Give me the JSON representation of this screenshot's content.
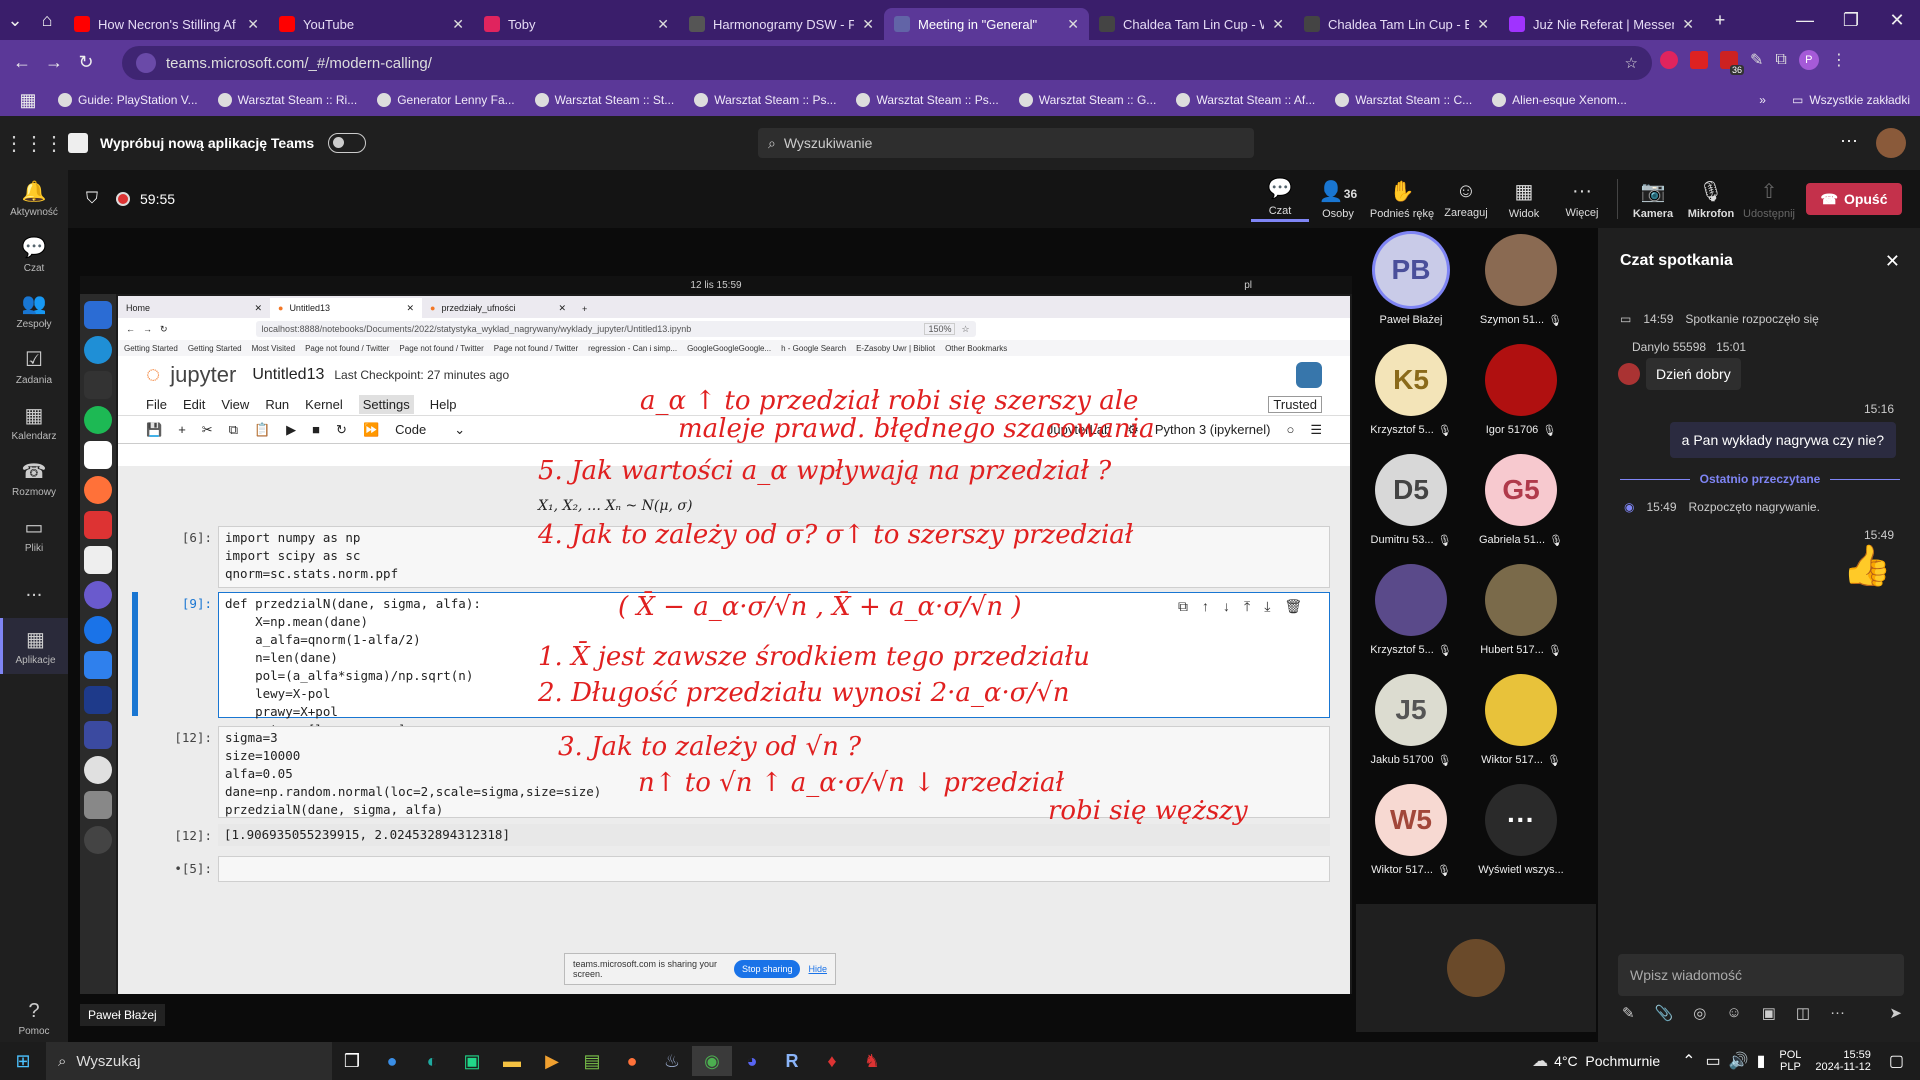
{
  "browser": {
    "tabs": [
      {
        "label": "How Necron's Stilling Af",
        "icon": "youtube-icon",
        "color": "#ff0000"
      },
      {
        "label": "YouTube",
        "icon": "youtube-icon",
        "color": "#ff0000"
      },
      {
        "label": "Toby",
        "icon": "toby-icon",
        "color": "#e0245e"
      },
      {
        "label": "Harmonogramy DSW - P",
        "icon": "wp-icon",
        "color": "#555"
      },
      {
        "label": "Meeting in \"General\"",
        "icon": "teams-icon",
        "color": "#6264a7"
      },
      {
        "label": "Chaldea Tam Lin Cup - W",
        "icon": "chaldea-icon",
        "color": "#444"
      },
      {
        "label": "Chaldea Tam Lin Cup - E",
        "icon": "chaldea-icon",
        "color": "#444"
      },
      {
        "label": "Już Nie Referat | Messen",
        "icon": "messenger-icon",
        "color": "#a033ff"
      }
    ],
    "url": "teams.microsoft.com/_#/modern-calling/",
    "bookmarks": [
      "Guide: PlayStation V...",
      "Warsztat Steam :: Ri...",
      "Generator Lenny Fa...",
      "Warsztat Steam :: St...",
      "Warsztat Steam :: Ps...",
      "Warsztat Steam :: Ps...",
      "Warsztat Steam :: G...",
      "Warsztat Steam :: Af...",
      "Warsztat Steam :: C...",
      "Alien-esque Xenom..."
    ],
    "bookmarks_all": "Wszystkie zakładki",
    "ext_badge": "36"
  },
  "teams": {
    "try_new": "Wypróbuj nową aplikację Teams",
    "search_placeholder": "Wyszukiwanie",
    "rail": [
      "Aktywność",
      "Czat",
      "Zespoły",
      "Zadania",
      "Kalendarz",
      "Rozmowy",
      "Pliki",
      "...",
      "Aplikacje",
      "Pomoc"
    ],
    "timer": "59:55",
    "controls": {
      "chat": "Czat",
      "people": "Osoby",
      "people_count": "36",
      "raise": "Podnieś rękę",
      "react": "Zareaguj",
      "view": "Widok",
      "more": "Więcej",
      "camera": "Kamera",
      "mic": "Mikrofon",
      "share": "Udostępnij",
      "leave": "Opuść"
    },
    "presenter": "Paweł Błażej"
  },
  "participants": [
    {
      "initials": "PB",
      "name": "Paweł Błażej",
      "bg": "#c9cbe8",
      "fg": "#4a4f9a",
      "muted": false
    },
    {
      "initials": "",
      "name": "Szymon 51...",
      "bg": "#8a6a52",
      "fg": "#fff",
      "muted": true
    },
    {
      "initials": "K5",
      "name": "Krzysztof 5...",
      "bg": "#f3e4b8",
      "fg": "#8a6a1a",
      "muted": true
    },
    {
      "initials": "",
      "name": "Igor 51706",
      "bg": "#b01010",
      "fg": "#fff",
      "muted": true
    },
    {
      "initials": "D5",
      "name": "Dumitru 53...",
      "bg": "#d8d8d8",
      "fg": "#444",
      "muted": true
    },
    {
      "initials": "G5",
      "name": "Gabriela 51...",
      "bg": "#f7c9cf",
      "fg": "#b03a4b",
      "muted": true
    },
    {
      "initials": "",
      "name": "Krzysztof 5...",
      "bg": "#5a4a8a",
      "fg": "#fff",
      "muted": true
    },
    {
      "initials": "",
      "name": "Hubert 517...",
      "bg": "#7a6a4a",
      "fg": "#fff",
      "muted": true
    },
    {
      "initials": "J5",
      "name": "Jakub 51700",
      "bg": "#dcdcd0",
      "fg": "#555",
      "muted": true
    },
    {
      "initials": "",
      "name": "Wiktor 517...",
      "bg": "#e8c23a",
      "fg": "#fff",
      "muted": true
    },
    {
      "initials": "W5",
      "name": "Wiktor 517...",
      "bg": "#f7d9d2",
      "fg": "#a2473a",
      "muted": true
    },
    {
      "initials": "···",
      "name": "Wyświetl wszys...",
      "bg": "#2a2a2a",
      "fg": "#fff",
      "muted": false
    }
  ],
  "chat": {
    "title": "Czat spotkania",
    "events": [
      {
        "time": "14:59",
        "text": "Spotkanie rozpoczęło się"
      }
    ],
    "msg1": {
      "author": "Danylo 55598",
      "time": "15:01",
      "text": "Dzień dobry"
    },
    "msg2": {
      "time": "15:16",
      "text": "a Pan wykłady nagrywa czy nie?"
    },
    "last_read": "Ostatnio przeczytane",
    "rec": {
      "time": "15:49",
      "text": "Rozpoczęto nagrywanie."
    },
    "emoji_time": "15:49",
    "input_placeholder": "Wpisz wiadomość"
  },
  "shared": {
    "ubuntu_time": "12 lis 15:59",
    "ubuntu_lang": "pl",
    "ff_tabs": [
      "Home",
      "Untitled13",
      "przedziały_ufności"
    ],
    "ff_url": "localhost:8888/notebooks/Documents/2022/statystyka_wyklad_nagrywany/wyklady_jupyter/Untitled13.ipynb",
    "ff_zoom": "150%",
    "ff_bookmarks": [
      "Getting Started",
      "Getting Started",
      "Most Visited",
      "Page not found / Twitter",
      "Page not found / Twitter",
      "Page not found / Twitter",
      "regression - Can i simp...",
      "GoogleGoogleGoogle...",
      "h - Google Search",
      "E-Zasoby Uwr | Bibliot",
      "Other Bookmarks"
    ],
    "jupyter_logo": "jupyter",
    "nb_title": "Untitled13",
    "checkpoint": "Last Checkpoint: 27 minutes ago",
    "menu": [
      "File",
      "Edit",
      "View",
      "Run",
      "Kernel",
      "Settings",
      "Help"
    ],
    "trusted": "Trusted",
    "celltype": "Code",
    "jlab": "JupyterLab",
    "kernel": "Python 3 (ipykernel)",
    "formula": "X₁, X₂, … Xₙ ~ N(μ, σ)",
    "cells": [
      {
        "prompt": "[6]:",
        "code": "import numpy as np\nimport scipy as sc\nqnorm=sc.stats.norm.ppf"
      },
      {
        "prompt": "[9]:",
        "code": "def przedzialN(dane, sigma, alfa):\n    X=np.mean(dane)\n    a_alfa=qnorm(1-alfa/2)\n    n=len(dane)\n    pol=(a_alfa*sigma)/np.sqrt(n)\n    lewy=X-pol\n    prawy=X+pol\n    return [lewy, prawy]"
      },
      {
        "prompt": "[12]:",
        "code": "sigma=3\nsize=10000\nalfa=0.05\ndane=np.random.normal(loc=2,scale=sigma,size=size)\nprzedzialN(dane, sigma, alfa)"
      },
      {
        "prompt": "[12]:",
        "code": "[1.906935055239915, 2.024532894312318]"
      },
      {
        "prompt": "•[5]:",
        "code": ""
      }
    ],
    "annotations": [
      "a_α ↑ to przedział robi się szerszy ale",
      "maleje prawd. błędnego szacowania",
      "5. Jak wartości a_α wpływają na przedział ?",
      "4. Jak to zależy od σ?   σ↑ to szerszy przedział",
      "( X̄ − a_α·σ/√n ,  X̄ + a_α·σ/√n )",
      "1. X̄ jest zawsze środkiem tego przedziału",
      "2. Długość przedziału wynosi  2·a_α·σ/√n",
      "3. Jak to zależy od √n ?",
      "n↑ to √n ↑      a_α·σ/√n ↓   przedział",
      "robi się węższy"
    ],
    "share_notice": "teams.microsoft.com is sharing your screen.",
    "stop_sharing": "Stop sharing",
    "hide": "Hide"
  },
  "taskbar": {
    "search": "Wyszukaj",
    "weather": "4°C  Pochmurnie",
    "lang1": "POL",
    "lang2": "PLP",
    "time": "15:59",
    "date": "2024-11-12"
  }
}
